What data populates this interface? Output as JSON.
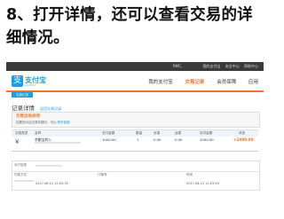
{
  "caption": "8、打开详情，还可以查看交易的详细情况。",
  "topbar": {
    "account": "RMC,",
    "links": [
      "我的支付宝",
      "安全中心",
      "帮助中心"
    ]
  },
  "header": {
    "logo_name": "支付宝",
    "logo_sub": "ALIPAY",
    "nav": [
      "我的支付宝",
      "交易记录",
      "会员保障",
      "应用"
    ],
    "active_nav": "交易记录"
  },
  "subnav": {
    "tab": "交易记录"
  },
  "detail": {
    "title": "记录详情",
    "crumb": "返回交易记录"
  },
  "status": {
    "label": "交易自动关闭",
    "tip": "如果您对此交易有疑问，可以",
    "tip_link": "联系客服"
  },
  "table": {
    "headers": [
      "交易类型",
      "名称",
      "支付金额",
      "数量",
      "优惠",
      "运费",
      "实付金额",
      "状态"
    ],
    "row": {
      "icon": "pay-icon",
      "name": "余额宝转入",
      "price": "1000.00",
      "qty": "1",
      "discount": "0.00",
      "fee": "0.00",
      "paid": "1000.00",
      "amount": "+1000.00"
    }
  },
  "info": {
    "counterparty_label": "对方信息",
    "payment_label": "付款方式",
    "order_label": "订单号",
    "time_label": "时间",
    "create_time": "2017.06.12 12:03:35",
    "close_time": "2017.06.12 12:03:49"
  },
  "colors": {
    "accent": "#f0712c",
    "brand": "#1a9fe0"
  }
}
